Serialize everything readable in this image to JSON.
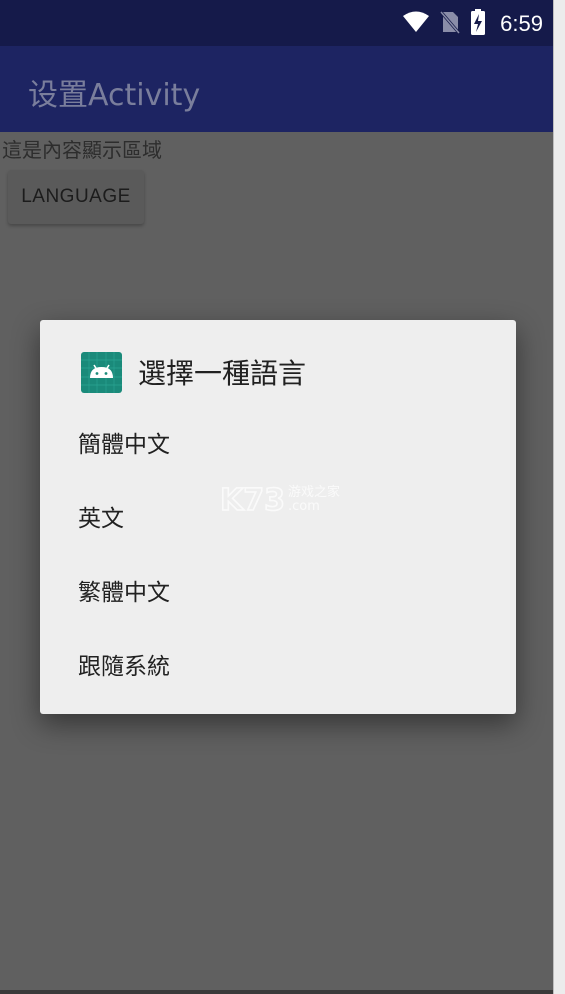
{
  "status_bar": {
    "time": "6:59",
    "icons": [
      "wifi-icon",
      "no-sim-icon",
      "battery-charging-icon"
    ]
  },
  "app_bar": {
    "title": "设置Activity"
  },
  "content": {
    "text": "這是內容顯示區域",
    "button_label": "LANGUAGE"
  },
  "dialog": {
    "icon": "android-app-icon",
    "title": "選擇一種語言",
    "items": [
      {
        "label": "簡體中文"
      },
      {
        "label": "英文"
      },
      {
        "label": "繁體中文"
      },
      {
        "label": "跟隨系統"
      }
    ]
  },
  "watermark": {
    "brand": "K73",
    "text": "游戏之家",
    "domain": ".com"
  },
  "colors": {
    "status_bar": "#151a4a",
    "app_bar": "#1d2462",
    "scrim_background": "#606060",
    "dialog_background": "#eeeeee",
    "app_icon": "#1a8a7a"
  }
}
